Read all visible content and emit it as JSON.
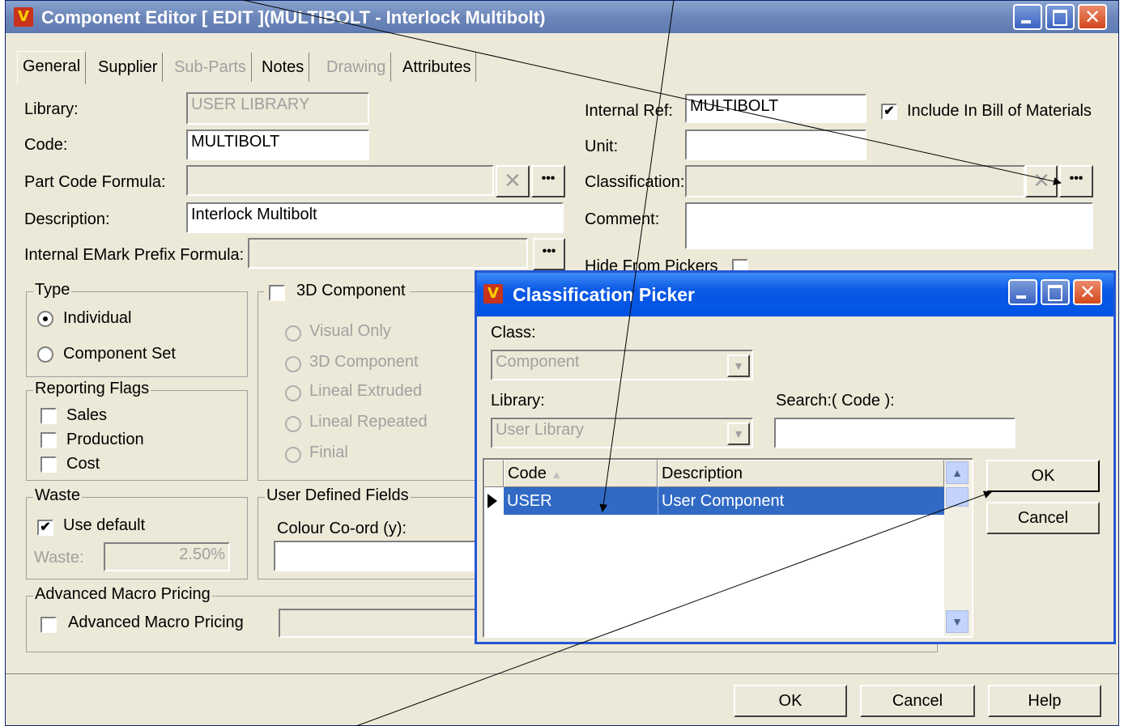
{
  "main_window": {
    "title": "Component Editor  [ EDIT ](MULTIBOLT - Interlock Multibolt)",
    "logo_text": "V",
    "tabs": [
      {
        "label": "General"
      },
      {
        "label": "Supplier"
      },
      {
        "label": "Sub-Parts"
      },
      {
        "label": "Notes"
      },
      {
        "label": "Drawing"
      },
      {
        "label": "Attributes"
      }
    ]
  },
  "general": {
    "library_label": "Library:",
    "library_value": "USER LIBRARY",
    "code_label": "Code:",
    "code_value": "MULTIBOLT",
    "part_code_formula_label": "Part Code Formula:",
    "description_label": "Description:",
    "description_value": "Interlock Multibolt",
    "emark_label": "Internal EMark Prefix Formula:",
    "internal_ref_label": "Internal Ref:",
    "internal_ref_value": "MULTIBOLT",
    "include_bom_label": "Include In Bill of Materials",
    "unit_label": "Unit:",
    "classification_label": "Classification:",
    "comment_label": "Comment:",
    "hide_from_pickers_label": "Hide From Pickers",
    "dots": "•••",
    "clear": "✕"
  },
  "type_group": {
    "title": "Type",
    "options": [
      "Individual",
      "Component Set"
    ],
    "selected": "Individual"
  },
  "component_3d": {
    "title": "3D Component",
    "options": [
      "Visual Only",
      "3D Component",
      "Lineal Extruded",
      "Lineal Repeated",
      "Finial"
    ]
  },
  "reporting_flags": {
    "title": "Reporting Flags",
    "items": [
      "Sales",
      "Production",
      "Cost"
    ]
  },
  "waste": {
    "title": "Waste",
    "use_default_label": "Use default",
    "waste_label": "Waste:",
    "waste_value": "2.50%"
  },
  "user_defined": {
    "title": "User Defined Fields",
    "colour_label": "Colour Co-ord (y):"
  },
  "advanced_macro": {
    "title": "Advanced Macro Pricing",
    "checkbox_label": "Advanced Macro Pricing"
  },
  "footer": {
    "ok": "OK",
    "cancel": "Cancel",
    "help": "Help"
  },
  "picker": {
    "title": "Classification Picker",
    "class_label": "Class:",
    "class_value": "Component",
    "library_label": "Library:",
    "library_value": "User Library",
    "search_label": "Search:( Code ):",
    "columns": [
      "Code",
      "Description"
    ],
    "rows": [
      {
        "code": "USER",
        "description": "User Component"
      }
    ],
    "ok": "OK",
    "cancel": "Cancel"
  }
}
